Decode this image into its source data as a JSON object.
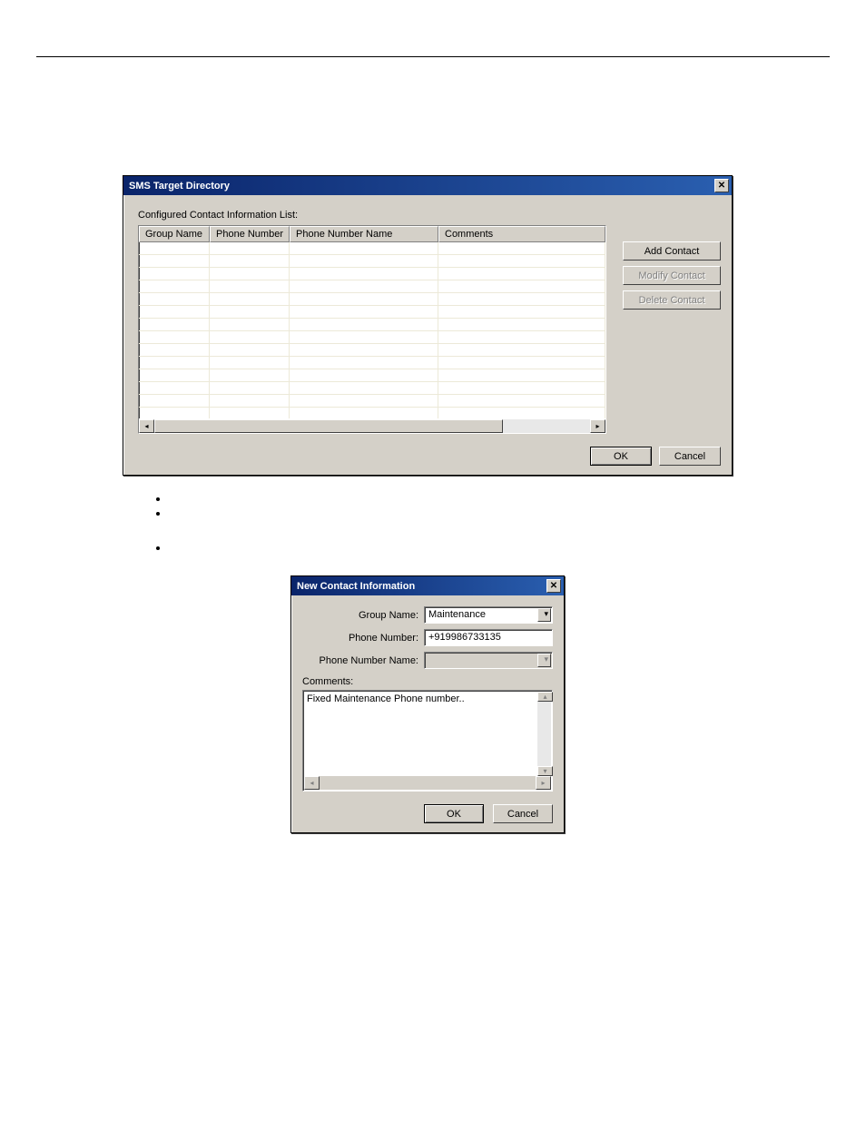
{
  "win1": {
    "title": "SMS Target Directory",
    "list_label": "Configured Contact Information List:",
    "columns": [
      "Group Name",
      "Phone Number",
      "Phone Number Name",
      "Comments"
    ],
    "add_label": "Add Contact",
    "modify_label": "Modify Contact",
    "delete_label": "Delete Contact",
    "ok_label": "OK",
    "cancel_label": "Cancel"
  },
  "bullets": {
    "b1": "",
    "b2": "",
    "b3": ""
  },
  "win2": {
    "title": "New Contact Information",
    "group_label": "Group Name:",
    "group_value": "Maintenance",
    "phone_label": "Phone Number:",
    "phone_value": "+919986733135",
    "pnname_label": "Phone Number Name:",
    "pnname_value": "",
    "comments_label": "Comments:",
    "comments_value": "Fixed Maintenance Phone number..",
    "ok_label": "OK",
    "cancel_label": "Cancel"
  }
}
